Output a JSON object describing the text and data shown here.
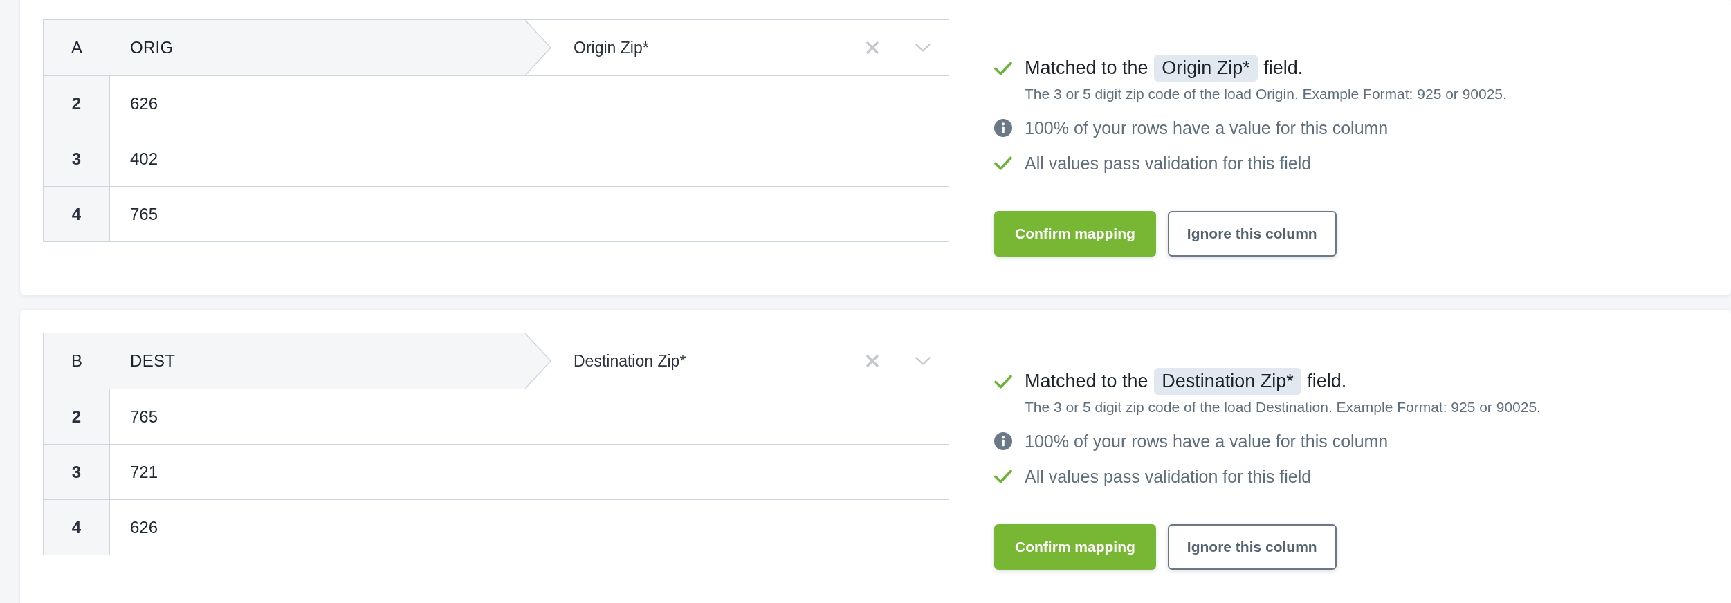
{
  "mappings": [
    {
      "column": {
        "letter": "A",
        "name": "ORIG"
      },
      "field_select": {
        "value": "Origin Zip*"
      },
      "rows": [
        {
          "number": "2",
          "value": "626"
        },
        {
          "number": "3",
          "value": "402"
        },
        {
          "number": "4",
          "value": "765"
        }
      ],
      "match": {
        "kind": "success",
        "prefix": "Matched to the",
        "field": "Origin Zip*",
        "suffix": "field.",
        "description": "The 3 or 5 digit zip code of the load Origin. Example Format: 925 or 90025."
      },
      "checks": [
        {
          "kind": "info",
          "text": "100% of your rows have a value for this column"
        },
        {
          "kind": "success",
          "text": "All values pass validation for this field"
        }
      ],
      "buttons": [
        {
          "kind": "primary",
          "label": "Confirm mapping"
        },
        {
          "kind": "secondary",
          "label": "Ignore this column"
        }
      ]
    },
    {
      "column": {
        "letter": "B",
        "name": "DEST"
      },
      "field_select": {
        "value": "Destination Zip*"
      },
      "rows": [
        {
          "number": "2",
          "value": "765"
        },
        {
          "number": "3",
          "value": "721"
        },
        {
          "number": "4",
          "value": "626"
        }
      ],
      "match": {
        "kind": "success",
        "prefix": "Matched to the",
        "field": "Destination Zip*",
        "suffix": "field.",
        "description": "The 3 or 5 digit zip code of the load Destination. Example Format: 925 or 90025."
      },
      "checks": [
        {
          "kind": "info",
          "text": "100% of your rows have a value for this column"
        },
        {
          "kind": "success",
          "text": "All values pass validation for this field"
        }
      ],
      "buttons": [
        {
          "kind": "primary",
          "label": "Confirm mapping"
        },
        {
          "kind": "secondary",
          "label": "Ignore this column"
        }
      ]
    }
  ]
}
